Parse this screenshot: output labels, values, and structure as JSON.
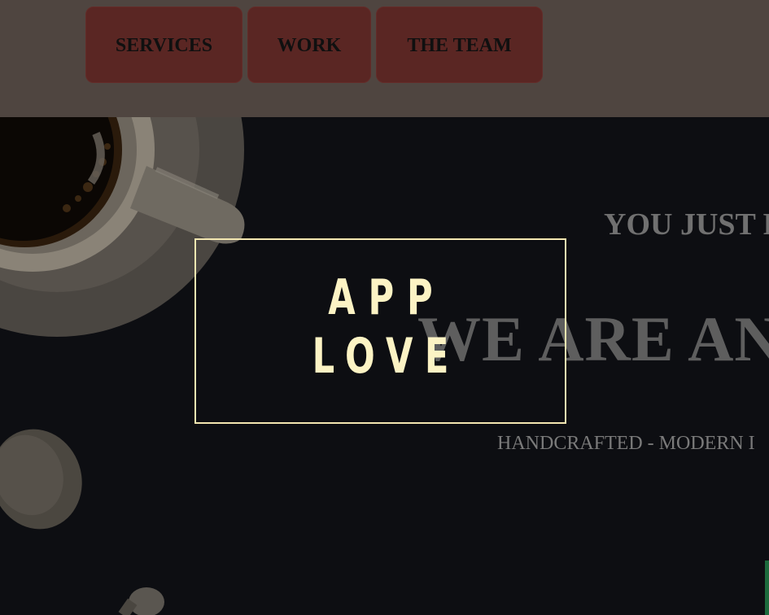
{
  "nav": {
    "items": [
      {
        "label": "SERVICES"
      },
      {
        "label": "WORK"
      },
      {
        "label": "THE TEAM"
      }
    ]
  },
  "hero": {
    "tagline_top": "YOU JUST F",
    "headline": "WE ARE AN",
    "subline": "HANDCRAFTED - MODERN I",
    "logo": {
      "line1": "APP",
      "line2": "LOVE"
    }
  },
  "colors": {
    "navbar_bg": "#4f4540",
    "nav_button_bg": "#5a2623",
    "hero_bg": "#0d0e12",
    "logo_cream": "#fcf3c4",
    "accent_green": "#1d6b3d"
  },
  "icons": {
    "coffee_illustration": "coffee-cup-saucer-spoon"
  }
}
